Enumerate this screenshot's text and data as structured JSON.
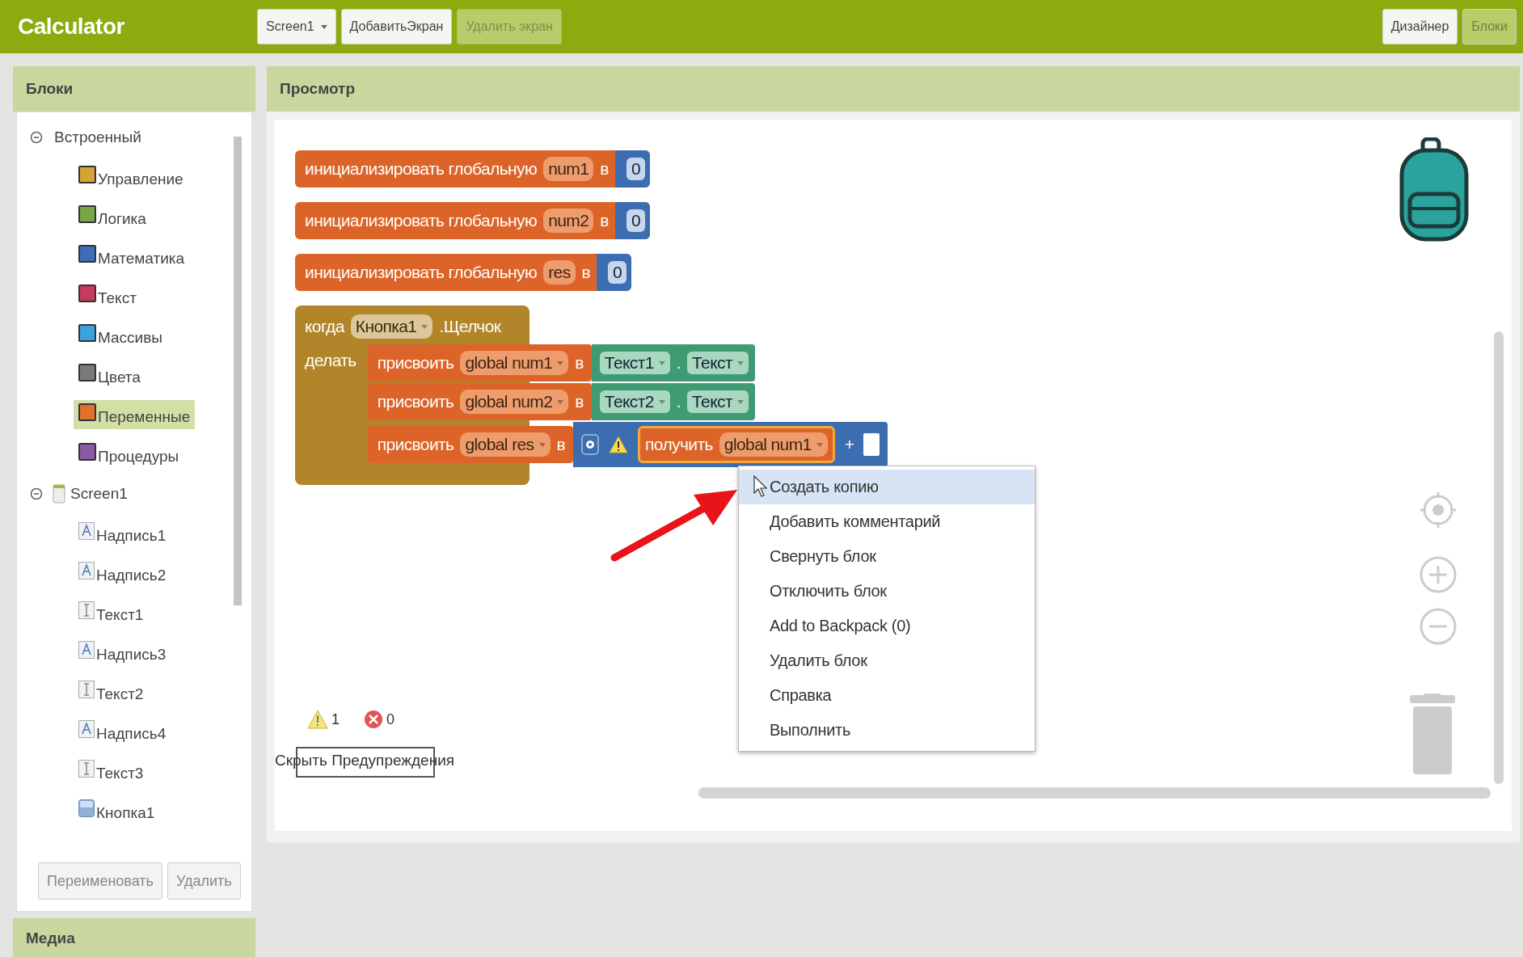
{
  "app_bar": {
    "title": "Calculator",
    "screen_dropdown": "Screen1",
    "buttons": [
      {
        "label": "ДобавитьЭкран",
        "disabled": false
      },
      {
        "label": "Удалить экран",
        "disabled": true
      }
    ],
    "view_buttons": [
      {
        "label": "Дизайнер",
        "selected": false
      },
      {
        "label": "Блоки",
        "selected": true
      }
    ]
  },
  "blocks_panel": {
    "title": "Блоки",
    "tree": [
      {
        "label": "Встроенный",
        "kind": "folder",
        "expanded": true,
        "selected": false,
        "children": [
          {
            "label": "Управление",
            "color": "#d6a436",
            "selected": false
          },
          {
            "label": "Логика",
            "color": "#77a845",
            "selected": false
          },
          {
            "label": "Математика",
            "color": "#3b6db8",
            "selected": false
          },
          {
            "label": "Текст",
            "color": "#c8385f",
            "selected": false
          },
          {
            "label": "Массивы",
            "color": "#3aa3dc",
            "selected": false
          },
          {
            "label": "Цвета",
            "color": "#7a7a7a",
            "selected": false
          },
          {
            "label": "Переменные",
            "color": "#e0702c",
            "selected": true
          },
          {
            "label": "Процедуры",
            "color": "#8a5aa6",
            "selected": false
          }
        ]
      },
      {
        "label": "Screen1",
        "kind": "screen",
        "expanded": true,
        "selected": false,
        "children": [
          {
            "label": "Надпись1",
            "kind": "label",
            "selected": false
          },
          {
            "label": "Надпись2",
            "kind": "label",
            "selected": false
          },
          {
            "label": "Текст1",
            "kind": "textbox",
            "selected": false
          },
          {
            "label": "Надпись3",
            "kind": "label",
            "selected": false
          },
          {
            "label": "Текст2",
            "kind": "textbox",
            "selected": false
          },
          {
            "label": "Надпись4",
            "kind": "label",
            "selected": false
          },
          {
            "label": "Текст3",
            "kind": "textbox",
            "selected": false
          },
          {
            "label": "Кнопка1",
            "kind": "button",
            "selected": false
          }
        ]
      }
    ],
    "buttons": [
      "Переименовать",
      "Удалить"
    ]
  },
  "media_panel": {
    "title": "Медиа"
  },
  "viewer": {
    "title": "Просмотр",
    "init_blocks": [
      {
        "label": "инициализировать глобальную",
        "name": "num1",
        "to": "в",
        "value": "0"
      },
      {
        "label": "инициализировать глобальную",
        "name": "num2",
        "to": "в",
        "value": "0"
      },
      {
        "label": "инициализировать глобальную",
        "name": "res",
        "to": "в",
        "value": "0"
      }
    ],
    "event_block": {
      "when": "когда",
      "component": "Кнопка1",
      "event": ".Щелчок",
      "do": "делать",
      "statements": [
        {
          "label": "присвоить",
          "variable": "global num1",
          "to": "в",
          "value": {
            "kind": "property",
            "component": "Текст1",
            "dot": ".",
            "property": "Текст"
          }
        },
        {
          "label": "присвоить",
          "variable": "global num2",
          "to": "в",
          "value": {
            "kind": "property",
            "component": "Текст2",
            "dot": ".",
            "property": "Текст"
          }
        },
        {
          "label": "присвоить",
          "variable": "global res",
          "to": "в",
          "value": {
            "kind": "math",
            "warning": true,
            "get": "получить",
            "variable": "global num1",
            "operator": "+"
          }
        }
      ]
    },
    "warnings": "1",
    "errors": "0",
    "hide_warnings_button": "Скрыть Предупреждения",
    "context_menu": [
      {
        "label": "Создать копию",
        "selected": true
      },
      {
        "label": "Добавить комментарий",
        "selected": false
      },
      {
        "label": "Свернуть блок",
        "selected": false
      },
      {
        "label": "Отключить блок",
        "selected": false
      },
      {
        "label": "Add to Backpack (0)",
        "selected": false
      },
      {
        "label": "Удалить блок",
        "selected": false
      },
      {
        "label": "Справка",
        "selected": false
      },
      {
        "label": "Выполнить",
        "selected": false
      }
    ]
  }
}
